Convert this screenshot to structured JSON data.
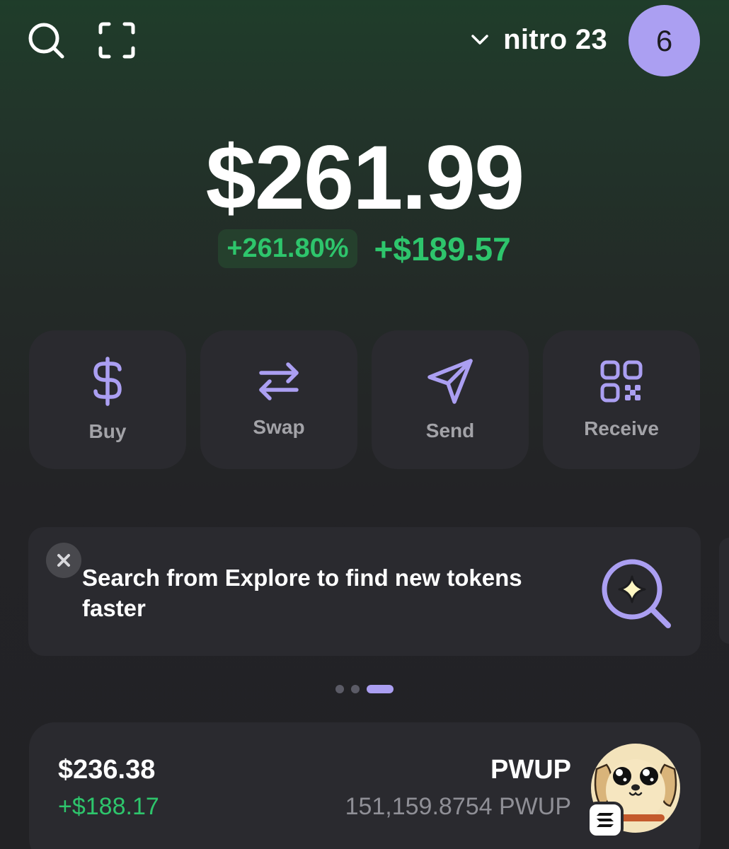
{
  "header": {
    "account_name": "nitro 23",
    "avatar_label": "6",
    "icons": [
      "search-icon",
      "scan-icon",
      "chevron-down-icon"
    ]
  },
  "portfolio": {
    "balance": "$261.99",
    "change_percent": "+261.80%",
    "change_amount": "+$189.57"
  },
  "actions": [
    {
      "label": "Buy",
      "icon": "dollar-icon"
    },
    {
      "label": "Swap",
      "icon": "swap-arrows-icon"
    },
    {
      "label": "Send",
      "icon": "send-icon"
    },
    {
      "label": "Receive",
      "icon": "qr-code-icon"
    }
  ],
  "banner": {
    "text": "Search from Explore to find new tokens faster",
    "icon": "sparkle-search-icon",
    "carousel_pages": 3,
    "carousel_active": 3
  },
  "tokens": [
    {
      "value": "$236.38",
      "change": "+$188.17",
      "symbol": "PWUP",
      "amount": "151,159.8754 PWUP",
      "logo": "pwup-dog-logo",
      "chain_badge": "solana-icon"
    }
  ],
  "colors": {
    "accent": "#ab9ff2",
    "positive": "#2ec56c",
    "card": "#2a2a2f"
  }
}
